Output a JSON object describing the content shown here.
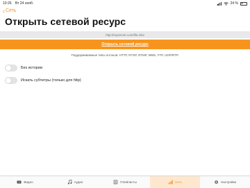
{
  "status_bar": {
    "time": "10:26",
    "date": "Вт 24 нояб.",
    "battery": "24 %",
    "battery_level": 0.24
  },
  "nav": {
    "back_label": "Сеть"
  },
  "page_title": "Открыть сетевой ресурс",
  "url_input": {
    "placeholder": "http://myserver.com/file.mkv"
  },
  "open_button": {
    "label": "Открыть сетевой ресурс"
  },
  "protocols_text": "Поддерживаемые типы потоков: HTTP, RTSP, RTMP, MMS, FTP, UDP/RTP.",
  "options": [
    {
      "label": "Без истории",
      "enabled": false
    },
    {
      "label": "Искать субтитры (только для http)",
      "enabled": false
    }
  ],
  "tabs": [
    {
      "label": "Видео",
      "icon": "video-icon",
      "active": false
    },
    {
      "label": "Аудио",
      "icon": "music-note-icon",
      "active": false
    },
    {
      "label": "Плейлисты",
      "icon": "playlist-icon",
      "active": false
    },
    {
      "label": "Сеть",
      "icon": "network-icon",
      "active": true
    },
    {
      "label": "Настройки",
      "icon": "gear-icon",
      "active": false
    }
  ],
  "colors": {
    "accent": "#f7941d",
    "active_tab_bg": "#fde8cf",
    "input_bg": "#e9e9eb"
  }
}
